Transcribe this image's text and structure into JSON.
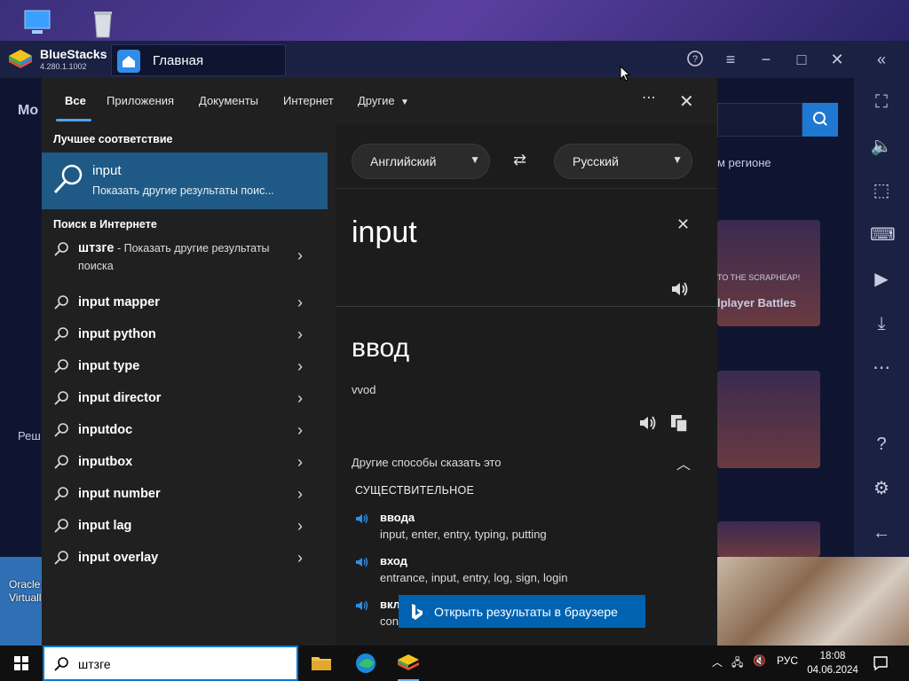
{
  "desktop": {
    "vbox_label_line1": "Oracle",
    "vbox_label_line2": "Virtuall"
  },
  "bluestacks": {
    "name": "BlueStacks",
    "version": "4.280.1.1002",
    "tab_label": "Главная",
    "peek_texts": [
      "м регионе",
      "TO THE SCRAPHEAP!",
      "lplayer Battles",
      "Мо",
      "Реш"
    ]
  },
  "search_panel": {
    "tabs": [
      "Все",
      "Приложения",
      "Документы",
      "Интернет",
      "Другие"
    ],
    "best_match_title": "Лучшее соответствие",
    "best_match": {
      "title": "input",
      "subtitle": "Показать другие результаты поис..."
    },
    "web_title": "Поиск в Интернете",
    "first_web": {
      "term": "штзге",
      "rest": " - Показать другие результаты поиска"
    },
    "web_results": [
      "input mapper",
      "input python",
      "input type",
      "input director",
      "inputdoc",
      "inputbox",
      "input number",
      "input lag",
      "input overlay"
    ],
    "translator": {
      "source_lang": "Английский",
      "target_lang": "Русский",
      "source_text": "input",
      "translation": "ввод",
      "romanization": "vvod",
      "other_ways": "Другие способы сказать это",
      "part_of_speech": "СУЩЕСТВИТЕЛЬНОЕ",
      "synonyms": [
        {
          "word": "ввода",
          "alts": "input, enter, entry, typing, putting"
        },
        {
          "word": "вход",
          "alts": "entrance, input, entry, log, sign, login"
        },
        {
          "word": "вкл",
          "alts": "con"
        }
      ]
    },
    "open_in_browser": "Открыть результаты в браузере"
  },
  "taskbar": {
    "search_value": "штзге",
    "lang": "РУС",
    "time": "18:08",
    "date": "04.06.2024"
  },
  "colors": {
    "accent": "#0078d7",
    "selected": "#1e5a85",
    "open_button": "#0063b1",
    "panel_bg": "#202020"
  }
}
